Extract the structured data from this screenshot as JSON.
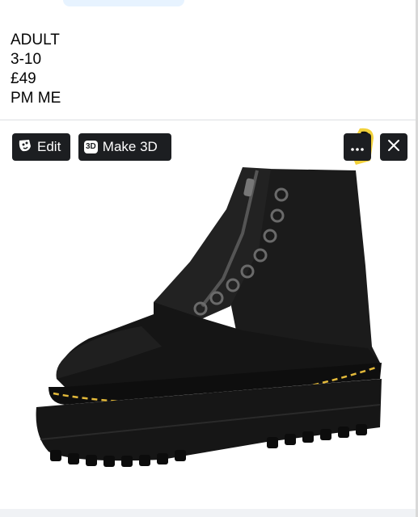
{
  "post": {
    "lines": [
      "ADULT",
      "3-10",
      "£49",
      "PM ME"
    ]
  },
  "photo_toolbar": {
    "edit_label": "Edit",
    "make3d_label": "Make 3D",
    "make3d_badge": "3D",
    "more_icon": "ellipsis-icon",
    "close_icon": "close-icon"
  },
  "colors": {
    "toolbar_button_bg": "#1c1e21",
    "boot_leather": "#1a1a1a",
    "stitch_yellow": "#e3b93a",
    "heel_tab_yellow": "#f2d13a"
  }
}
